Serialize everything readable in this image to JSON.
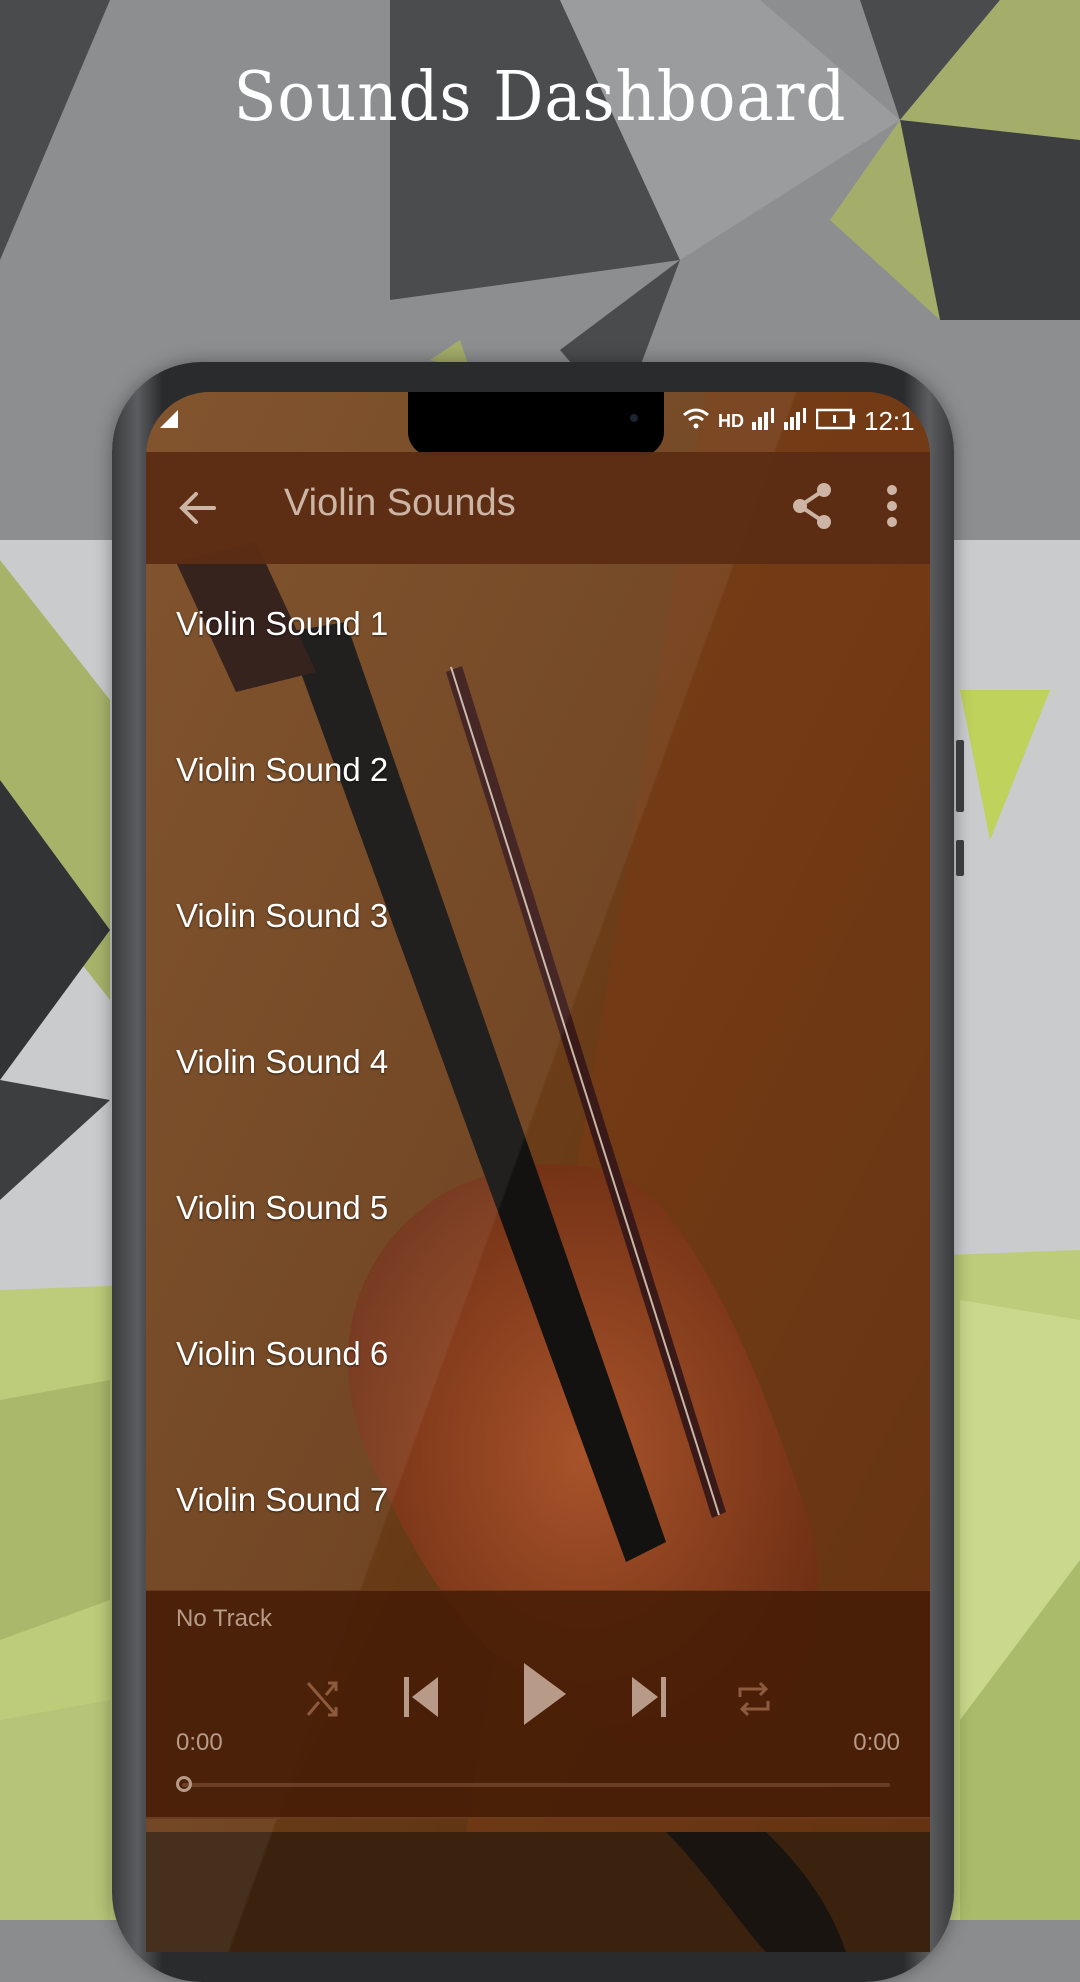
{
  "promo": {
    "headline": "Sounds Dashboard"
  },
  "status_bar": {
    "time": "12:1",
    "icons": [
      "image-icon",
      "wifi-icon",
      "hd-call-icon",
      "signal-icon",
      "signal-icon",
      "battery-icon"
    ]
  },
  "app_bar": {
    "title": "Violin Sounds",
    "back_icon": "arrow-left-icon",
    "share_icon": "share-icon",
    "more_icon": "more-vertical-icon"
  },
  "sound_list": {
    "items": [
      {
        "label": "Violin Sound 1"
      },
      {
        "label": "Violin Sound 2"
      },
      {
        "label": "Violin Sound 3"
      },
      {
        "label": "Violin Sound 4"
      },
      {
        "label": "Violin Sound 5"
      },
      {
        "label": "Violin Sound 6"
      },
      {
        "label": "Violin Sound 7"
      }
    ]
  },
  "player": {
    "track_title": "No Track",
    "elapsed": "0:00",
    "duration": "0:00",
    "progress": 0,
    "controls": [
      "shuffle-icon",
      "skip-previous-icon",
      "play-icon",
      "skip-next-icon",
      "repeat-icon"
    ]
  },
  "colors": {
    "app_bar": "#5c2d14",
    "player_bg": "#461c06",
    "muted_text": "#b79a88",
    "title_text": "#cdb5a6"
  }
}
